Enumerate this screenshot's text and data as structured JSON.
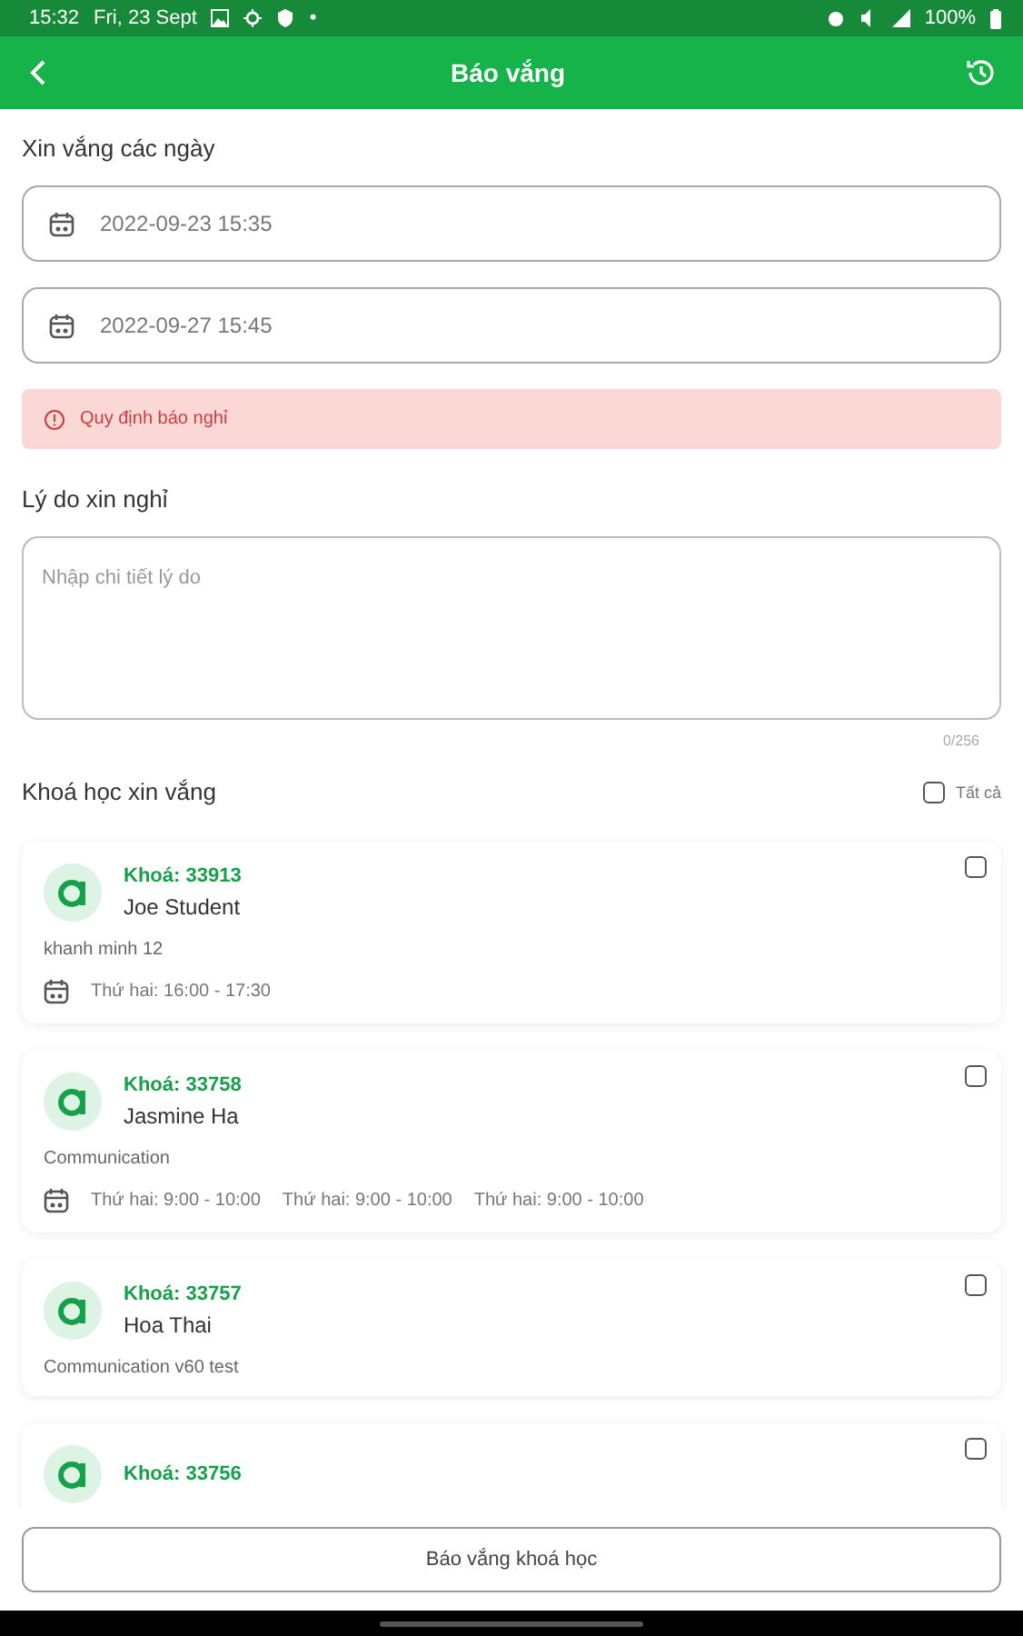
{
  "status_bar": {
    "time": "15:32",
    "date": "Fri, 23 Sept",
    "dot": "•",
    "battery": "100%"
  },
  "app_bar": {
    "title": "Báo vắng"
  },
  "dates_section": {
    "label": "Xin vắng các ngày",
    "fields": [
      {
        "value": "2022-09-23 15:35"
      },
      {
        "value": "2022-09-27 15:45"
      }
    ]
  },
  "notice": {
    "text": "Quy định báo nghỉ"
  },
  "reason": {
    "label": "Lý do xin nghỉ",
    "placeholder": "Nhập chi tiết lý do",
    "counter": "0/256"
  },
  "courses_section": {
    "label": "Khoá học xin vắng",
    "select_all": {
      "label": "Tất cả",
      "checked": false
    }
  },
  "courses": [
    {
      "code": "Khoá: 33913",
      "name": "Joe Student",
      "title": "khanh minh 12",
      "schedule": [
        "Thứ hai: 16:00 - 17:30"
      ],
      "checked": false
    },
    {
      "code": "Khoá: 33758",
      "name": "Jasmine Ha",
      "title": "Communication",
      "schedule": [
        "Thứ hai: 9:00 - 10:00",
        "Thứ hai: 9:00 - 10:00",
        "Thứ hai: 9:00 - 10:00"
      ],
      "checked": false
    },
    {
      "code": "Khoá: 33757",
      "name": "Hoa Thai",
      "title": "Communication v60 test",
      "checked": false
    },
    {
      "code": "Khoá: 33756",
      "checked": false
    }
  ],
  "submit_button": {
    "label": "Báo vắng khoá học"
  }
}
